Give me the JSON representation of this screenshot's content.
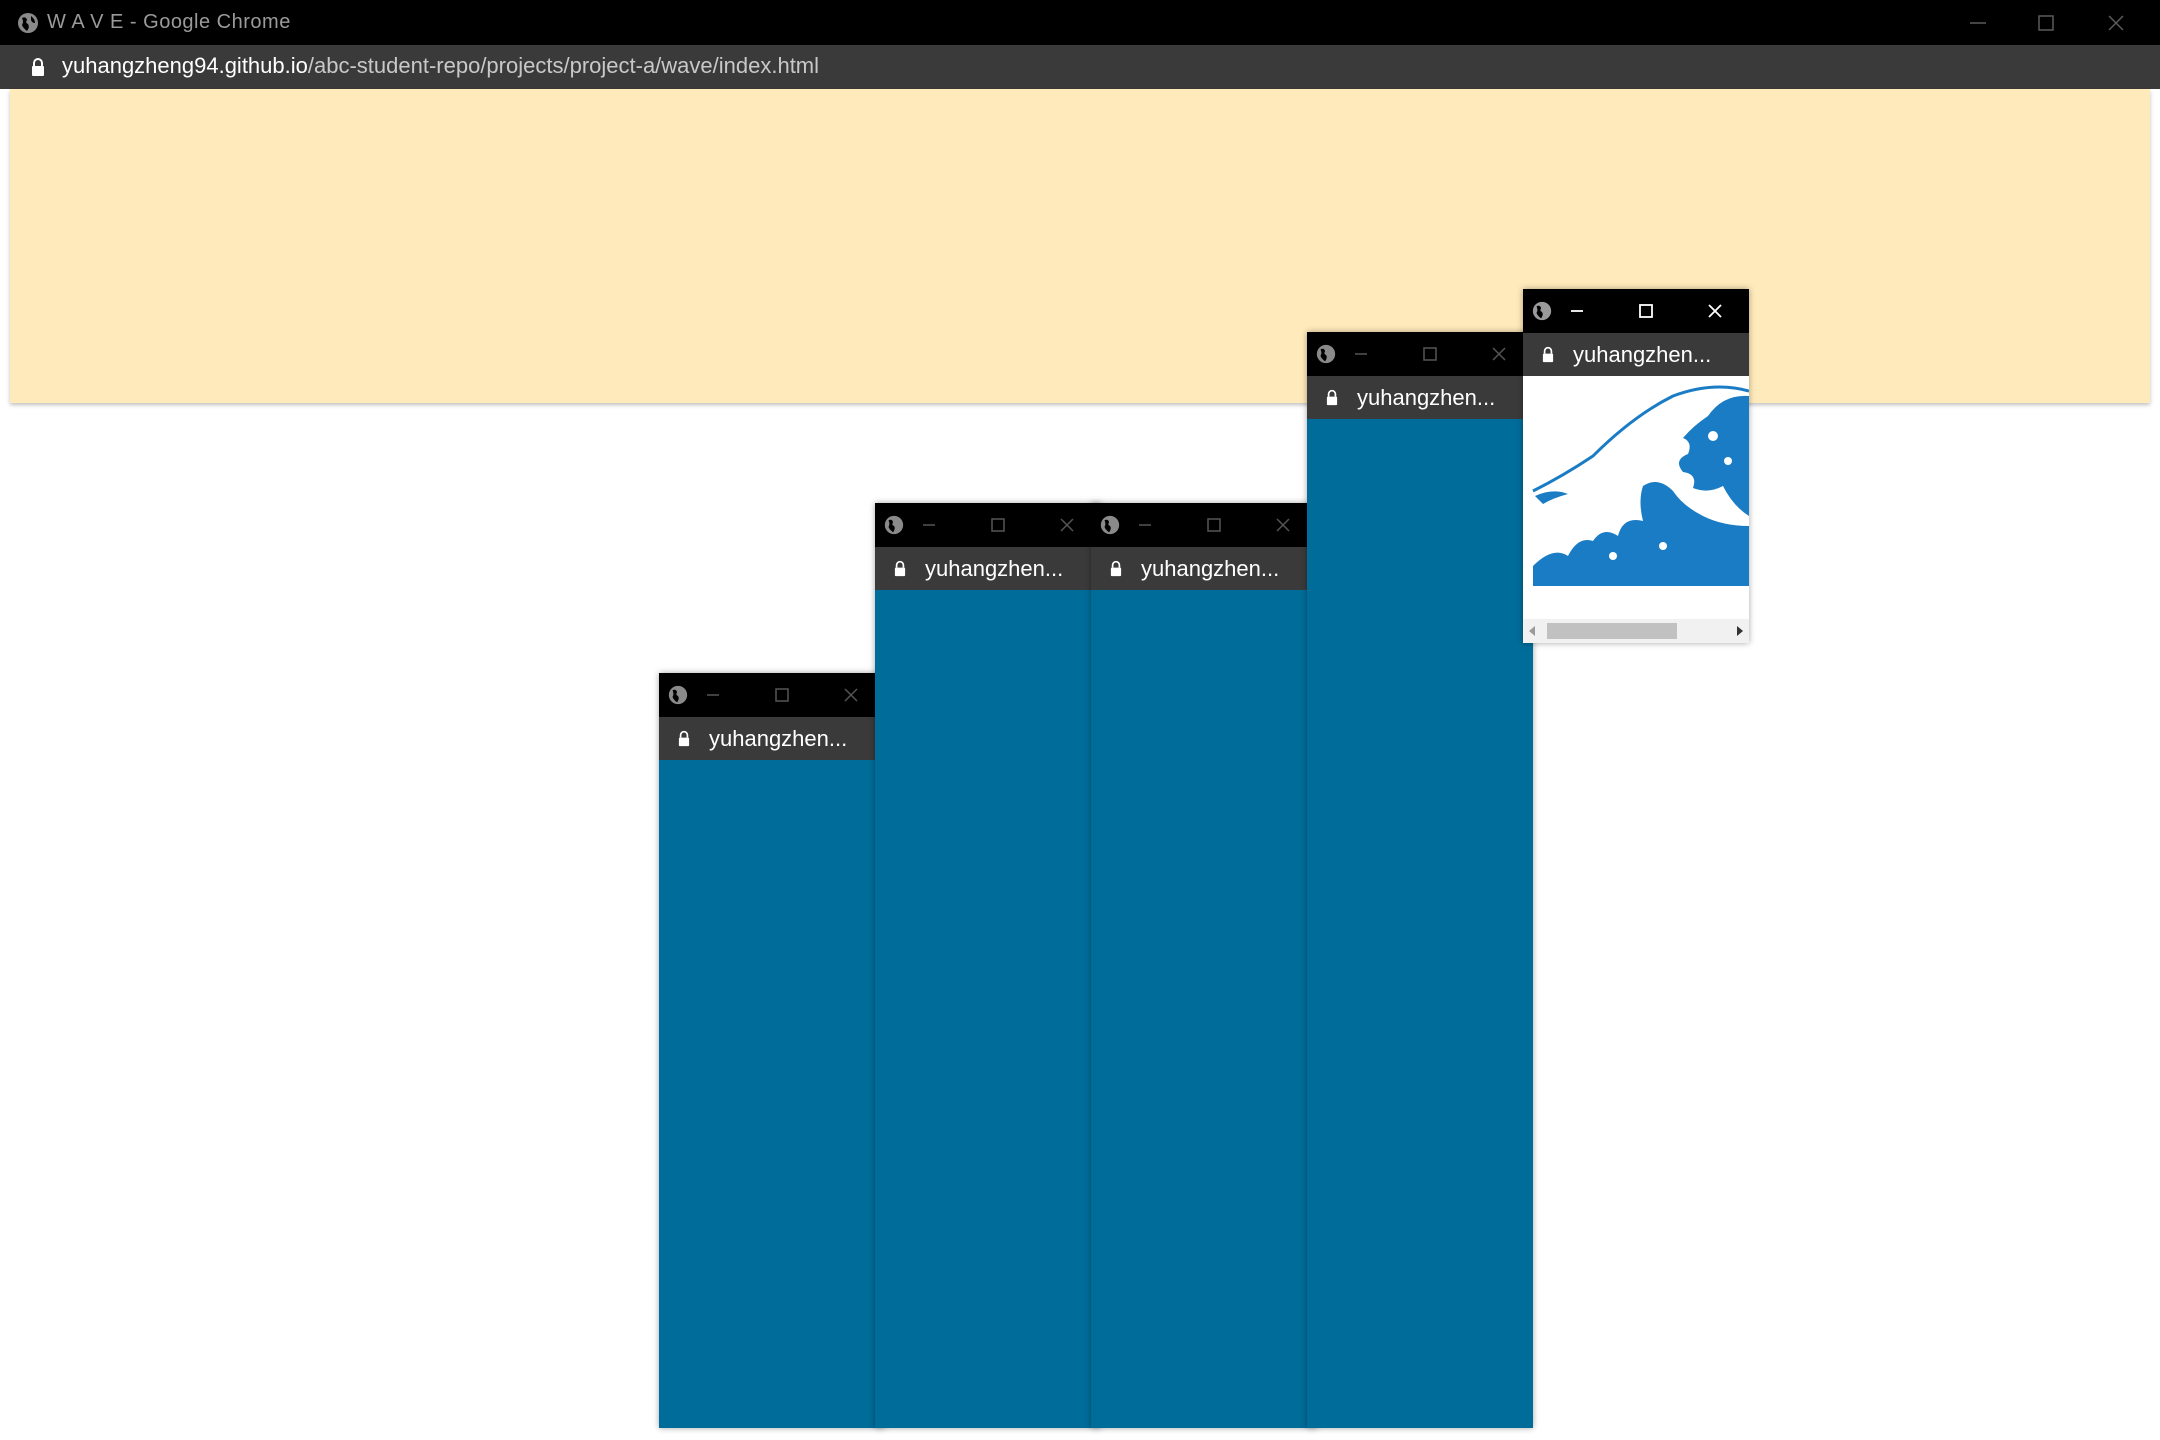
{
  "main": {
    "title": "W A V E - Google Chrome",
    "url_host": "yuhangzheng94.github.io",
    "url_path": "/abc-student-repo/projects/project-a/wave/index.html"
  },
  "popups": [
    {
      "label": "yuhangzhen..."
    },
    {
      "label": "yuhangzhen..."
    },
    {
      "label": "yuhangzhen..."
    },
    {
      "label": "yuhangzhen..."
    },
    {
      "label": "yuhangzhen..."
    }
  ],
  "colors": {
    "banner": "#ffeabb",
    "popup_body": "#006c99",
    "wave": "#1a7cc4"
  },
  "icons": [
    "globe-icon",
    "lock-icon",
    "minimize-icon",
    "maximize-icon",
    "close-icon",
    "wave-image"
  ]
}
